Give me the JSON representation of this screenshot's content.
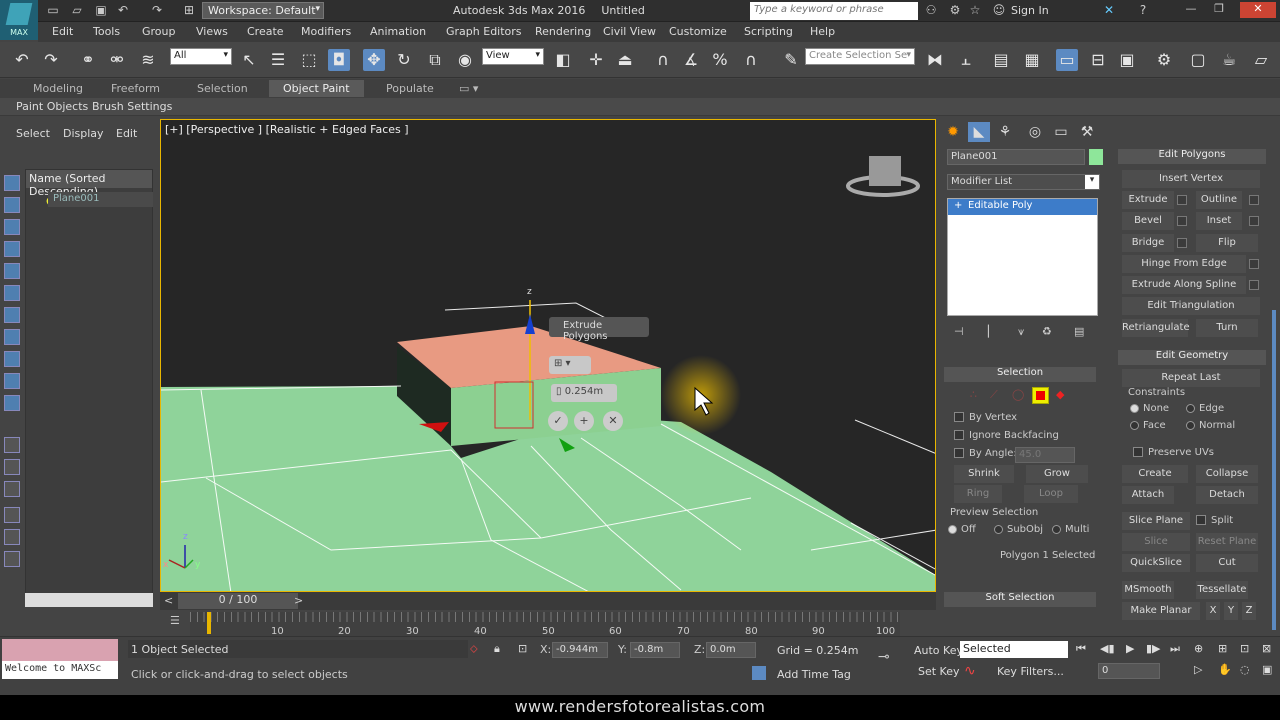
{
  "titlebar": {
    "app_icon": "MAX",
    "workspace": "Workspace: Default",
    "title": "Autodesk 3ds Max 2016",
    "doc": "Untitled",
    "search_placeholder": "Type a keyword or phrase",
    "signin": "Sign In"
  },
  "menus": [
    "Edit",
    "Tools",
    "Group",
    "Views",
    "Create",
    "Modifiers",
    "Animation",
    "Graph Editors",
    "Rendering",
    "Civil View",
    "Customize",
    "Scripting",
    "Help"
  ],
  "toolbar": {
    "filter": "All",
    "refcoord": "View",
    "selset": "Create Selection Se"
  },
  "ribbon": {
    "tabs": [
      "Modeling",
      "Freeform",
      "Selection",
      "Object Paint",
      "Populate"
    ],
    "active": "Object Paint",
    "sub": [
      "Paint Objects",
      "Brush Settings"
    ]
  },
  "scene": {
    "tabs": [
      "Select",
      "Display",
      "Edit"
    ],
    "column": "Name (Sorted Descending)",
    "item": "Plane001"
  },
  "viewport": {
    "label": "[+] [Perspective ] [Realistic + Edged Faces ]",
    "caddy_title": "Extrude Polygons",
    "caddy_value": "0.254m",
    "axis_z": "z",
    "axis_x": "x",
    "axis_y": "y"
  },
  "cmd": {
    "object_name": "Plane001",
    "modlist": "Modifier List",
    "stack_item": "Editable Poly",
    "selection": {
      "title": "Selection",
      "by_vertex": "By Vertex",
      "ignore_backfacing": "Ignore Backfacing",
      "by_angle": "By Angle:",
      "angle_value": "45.0",
      "shrink": "Shrink",
      "grow": "Grow",
      "ring": "Ring",
      "loop": "Loop",
      "preview": "Preview Selection",
      "off": "Off",
      "subobj": "SubObj",
      "multi": "Multi",
      "status": "Polygon 1 Selected"
    },
    "soft_selection": "Soft Selection"
  },
  "edit_polygons": {
    "title": "Edit Polygons",
    "insert_vertex": "Insert Vertex",
    "extrude": "Extrude",
    "outline": "Outline",
    "bevel": "Bevel",
    "inset": "Inset",
    "bridge": "Bridge",
    "flip": "Flip",
    "hinge": "Hinge From Edge",
    "extrude_spline": "Extrude Along Spline",
    "edit_tri": "Edit Triangulation",
    "retri": "Retriangulate",
    "turn": "Turn"
  },
  "edit_geometry": {
    "title": "Edit Geometry",
    "repeat_last": "Repeat Last",
    "constraints": "Constraints",
    "none": "None",
    "edge": "Edge",
    "face": "Face",
    "normal": "Normal",
    "preserve_uvs": "Preserve UVs",
    "create": "Create",
    "collapse": "Collapse",
    "attach": "Attach",
    "detach": "Detach",
    "slice_plane": "Slice Plane",
    "split": "Split",
    "slice": "Slice",
    "reset_plane": "Reset Plane",
    "quickslice": "QuickSlice",
    "cut": "Cut",
    "msmooth": "MSmooth",
    "tessellate": "Tessellate",
    "make_planar": "Make Planar",
    "x": "X",
    "y": "Y",
    "z": "Z"
  },
  "timeline": {
    "frame": "0 / 100",
    "ticks": [
      "10",
      "20",
      "30",
      "40",
      "50",
      "60",
      "70",
      "80",
      "90",
      "100"
    ]
  },
  "status": {
    "maxscript": "Welcome to MAXSc",
    "selected": "1 Object Selected",
    "prompt": "Click or click-and-drag to select objects",
    "x_label": "X:",
    "x": "-0.944m",
    "y_label": "Y:",
    "y": "-0.8m",
    "z_label": "Z:",
    "z": "0.0m",
    "grid": "Grid = 0.254m",
    "add_time_tag": "Add Time Tag",
    "auto_key": "Auto Key",
    "set_key": "Set Key",
    "selected_dd": "Selected",
    "key_filters": "Key Filters...",
    "frame_field": "0"
  },
  "watermark": "www.rendersfotorealistas.com"
}
